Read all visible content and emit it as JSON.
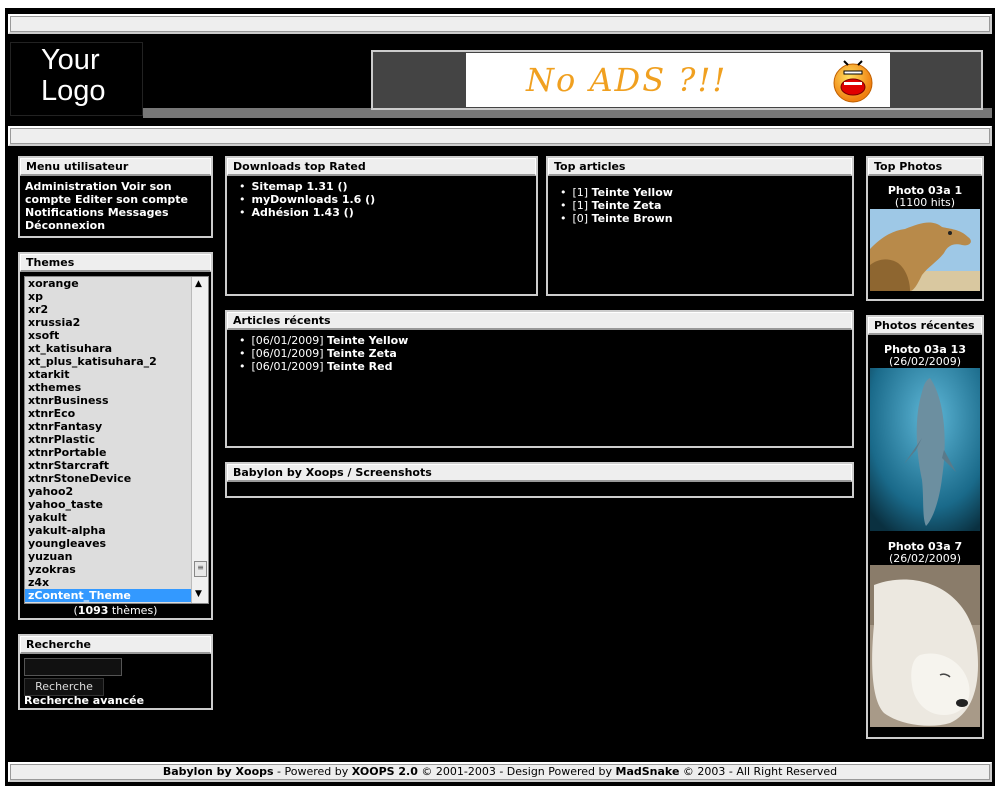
{
  "header": {
    "logo_text": "Your\nLogo",
    "ad_text": "No ADS ?!!"
  },
  "menu": {
    "title": "Menu utilisateur",
    "items": [
      "Administration",
      "Voir son compte",
      "Editer son compte",
      "Notifications",
      "Messages",
      "Déconnexion"
    ]
  },
  "themes": {
    "title": "Themes",
    "items": [
      "xorange",
      "xp",
      "xr2",
      "xrussia2",
      "xsoft",
      "xt_katisuhara",
      "xt_plus_katisuhara_2",
      "xtarkit",
      "xthemes",
      "xtnrBusiness",
      "xtnrEco",
      "xtnrFantasy",
      "xtnrPlastic",
      "xtnrPortable",
      "xtnrStarcraft",
      "xtnrStoneDevice",
      "yahoo2",
      "yahoo_taste",
      "yakult",
      "yakult-alpha",
      "youngleaves",
      "yuzuan",
      "yzokras",
      "z4x",
      "zContent_Theme"
    ],
    "selected": "zContent_Theme",
    "count": "1093",
    "count_suffix": " thèmes)",
    "count_prefix": "("
  },
  "search": {
    "title": "Recherche",
    "button": "Recherche",
    "advanced": "Recherche avancée"
  },
  "downloads": {
    "title": "Downloads top Rated",
    "items": [
      "Sitemap 1.31 ()",
      "myDownloads 1.6 ()",
      "Adhésion 1.43 ()"
    ]
  },
  "top_articles": {
    "title": "Top articles",
    "items": [
      {
        "count": "[1]",
        "name": "Teinte Yellow"
      },
      {
        "count": "[1]",
        "name": "Teinte Zeta"
      },
      {
        "count": "[0]",
        "name": "Teinte Brown"
      }
    ]
  },
  "recent_articles": {
    "title": "Articles récents",
    "items": [
      {
        "date": "[06/01/2009]",
        "name": "Teinte Yellow"
      },
      {
        "date": "[06/01/2009]",
        "name": "Teinte Zeta"
      },
      {
        "date": "[06/01/2009]",
        "name": "Teinte Red"
      }
    ]
  },
  "screenshots": {
    "title": "Babylon by Xoops / Screenshots"
  },
  "top_photos": {
    "title": "Top Photos",
    "items": [
      {
        "name": "Photo 03a 1",
        "meta": "(1100 hits)",
        "icon": "camel-photo"
      }
    ]
  },
  "recent_photos": {
    "title": "Photos récentes",
    "items": [
      {
        "name": "Photo 03a 13",
        "meta": "(26/02/2009)",
        "icon": "dolphin-photo"
      },
      {
        "name": "Photo 03a 7",
        "meta": "(26/02/2009)",
        "icon": "polar-bear-photo"
      }
    ]
  },
  "footer": {
    "site": "Babylon by Xoops",
    "t1": " - Powered by ",
    "xoops": "XOOPS 2.0",
    "t2": " © 2001-2003 - Design Powered by ",
    "author": "MadSnake",
    "t3": " © 2003 - All Right Reserved"
  }
}
